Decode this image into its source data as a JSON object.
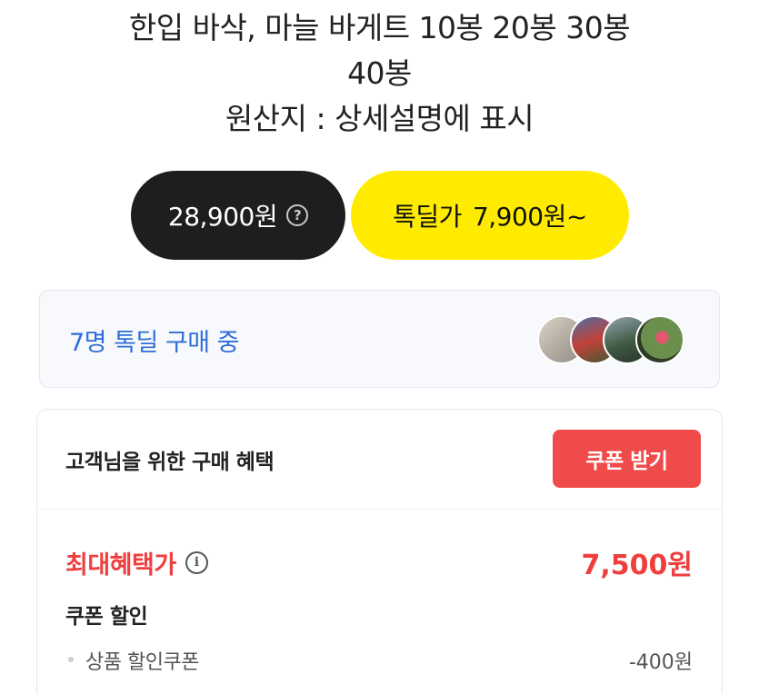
{
  "product": {
    "title_line1": "한입 바삭, 마늘 바게트 10봉 20봉 30봉",
    "title_line2": "40봉",
    "origin": "원산지 : 상세설명에 표시"
  },
  "pricing": {
    "regular_price": "28,900원",
    "help_icon": "question-circle-icon",
    "deal_label": "톡딜가",
    "deal_price": "7,900원~"
  },
  "buyers": {
    "text": "7명 톡딜 구매 중",
    "avatar_count": 4
  },
  "benefits": {
    "title": "고객님을 위한 구매 혜택",
    "coupon_button": "쿠폰 받기",
    "max_benefit_label": "최대혜택가",
    "max_benefit_value": "7,500원",
    "coupon_discount_label": "쿠폰 할인",
    "items": [
      {
        "label": "상품 할인쿠폰",
        "value": "-400원"
      }
    ]
  },
  "colors": {
    "dark_pill": "#1e1e1e",
    "deal_yellow": "#ffeb00",
    "buyers_blue": "#2f6ed6",
    "accent_red": "#ee3e3e",
    "coupon_button": "#f04b4b"
  }
}
